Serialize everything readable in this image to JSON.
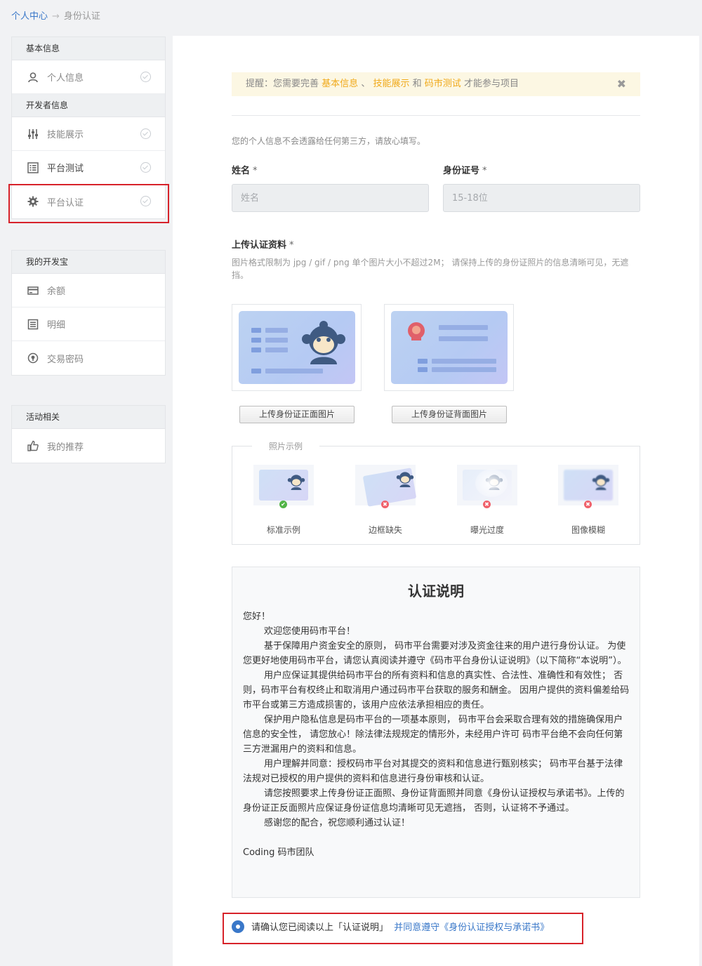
{
  "breadcrumb": {
    "home": "个人中心",
    "separator": "→",
    "current": "身份认证"
  },
  "sidebar": {
    "basic": {
      "title": "基本信息",
      "items": [
        {
          "label": "个人信息",
          "icon": "user-icon"
        }
      ]
    },
    "developer": {
      "title": "开发者信息",
      "items": [
        {
          "label": "技能展示",
          "icon": "sliders-icon"
        },
        {
          "label": "平台测试",
          "icon": "list-icon"
        },
        {
          "label": "平台认证",
          "icon": "gear-icon"
        }
      ]
    },
    "wallet": {
      "title": "我的开发宝",
      "items": [
        {
          "label": "余额",
          "icon": "card-icon"
        },
        {
          "label": "明细",
          "icon": "receipt-icon"
        },
        {
          "label": "交易密码",
          "icon": "pin-icon"
        }
      ]
    },
    "activity": {
      "title": "活动相关",
      "items": [
        {
          "label": "我的推荐",
          "icon": "thumbs-up-icon"
        }
      ]
    }
  },
  "notice": {
    "prefix": "提醒：您需要完善",
    "link1": "基本信息",
    "sep1": "、",
    "link2": "技能展示",
    "sep2": "和",
    "link3": "码市测试",
    "suffix": "才能参与项目",
    "close": "✖"
  },
  "form": {
    "privacy": "您的个人信息不会透露给任何第三方，请放心填写。",
    "name_label": "姓名",
    "name_placeholder": "姓名",
    "id_label": "身份证号",
    "id_placeholder": "15-18位",
    "required_mark": "*",
    "upload_label": "上传认证资料",
    "upload_desc": "图片格式限制为 jpg / gif / png 单个图片大小不超过2M； 请保持上传的身份证照片的信息清晰可见，无遮挡。",
    "front_button": "上传身份证正面图片",
    "back_button": "上传身份证背面图片"
  },
  "examples": {
    "title": "照片示例",
    "items": [
      {
        "label": "标准示例",
        "status": "ok"
      },
      {
        "label": "边框缺失",
        "status": "bad"
      },
      {
        "label": "曝光过度",
        "status": "bad"
      },
      {
        "label": "图像模糊",
        "status": "bad"
      }
    ],
    "ok_color": "#52b447",
    "bad_color": "#f0606a"
  },
  "terms": {
    "title": "认证说明",
    "greeting": "您好！",
    "paragraphs": [
      "欢迎您使用码市平台！",
      "基于保障用户资金安全的原则， 码市平台需要对涉及资金往来的用户进行身份认证。 为使您更好地使用码市平台，请您认真阅读并遵守《码市平台身份认证说明》（以下简称“本说明”）。",
      "用户应保证其提供给码市平台的所有资料和信息的真实性、合法性、准确性和有效性； 否则，码市平台有权终止和取消用户通过码市平台获取的服务和酬金。 因用户提供的资料偏差给码市平台或第三方造成损害的，该用户应依法承担相应的责任。",
      "保护用户隐私信息是码市平台的一项基本原则， 码市平台会采取合理有效的措施确保用户信息的安全性， 请您放心！除法律法规规定的情形外，未经用户许可 码市平台绝不会向任何第三方泄漏用户的资料和信息。",
      "用户理解并同意：授权码市平台对其提交的资料和信息进行甄别核实； 码市平台基于法律法规对已授权的用户提供的资料和信息进行身份审核和认证。",
      "请您按照要求上传身份证正面照、身份证背面照并同意《身份认证授权与承诺书》。上传的身份证正反面照片应保证身份证信息均清晰可见无遮挡， 否则，认证将不予通过。",
      "感谢您的配合，祝您顺利通过认证！"
    ],
    "signature": "Coding 码市团队"
  },
  "confirm": {
    "text": "请确认您已阅读以上「认证说明」",
    "agree": "并同意遵守《身份认证授权与承诺书》"
  },
  "colors": {
    "accent": "#3a78c9",
    "highlight": "#d7222a",
    "warning": "#f0a91a"
  }
}
